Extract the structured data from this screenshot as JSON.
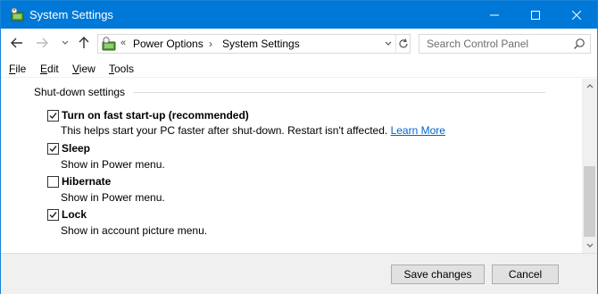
{
  "window": {
    "title": "System Settings",
    "icon": "power-options-icon",
    "controls": [
      "minimize-icon",
      "maximize-icon",
      "close-icon"
    ]
  },
  "address_bar": {
    "overflow": "«",
    "breadcrumb": [
      "Power Options",
      "System Settings"
    ],
    "separator": "›"
  },
  "search": {
    "placeholder": "Search Control Panel"
  },
  "menu": {
    "items": [
      "File",
      "Edit",
      "View",
      "Tools"
    ]
  },
  "content": {
    "section_title": "Shut-down settings",
    "options": [
      {
        "label": "Turn on fast start-up (recommended)",
        "checked": true,
        "description": "This helps start your PC faster after shut-down. Restart isn't affected.",
        "link": "Learn More"
      },
      {
        "label": "Sleep",
        "checked": true,
        "description": "Show in Power menu."
      },
      {
        "label": "Hibernate",
        "checked": false,
        "description": "Show in Power menu."
      },
      {
        "label": "Lock",
        "checked": true,
        "description": "Show in account picture menu."
      }
    ]
  },
  "footer": {
    "save_label": "Save changes",
    "cancel_label": "Cancel"
  },
  "colors": {
    "titlebar": "#0078d7",
    "link": "#0066cc",
    "footer_bg": "#f0f0f0"
  }
}
